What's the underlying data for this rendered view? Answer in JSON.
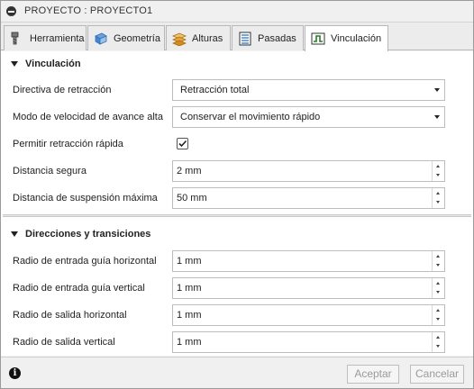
{
  "window": {
    "title": "PROYECTO : PROYECTO1"
  },
  "tabs": [
    {
      "label": "Herramienta",
      "icon": "tool-icon",
      "active": false
    },
    {
      "label": "Geometría",
      "icon": "geometry-icon",
      "active": false
    },
    {
      "label": "Alturas",
      "icon": "heights-icon",
      "active": false
    },
    {
      "label": "Pasadas",
      "icon": "passes-icon",
      "active": false
    },
    {
      "label": "Vinculación",
      "icon": "linking-icon",
      "active": true
    }
  ],
  "sections": {
    "linking": {
      "title": "Vinculación",
      "retract_policy": {
        "label": "Directiva de retracción",
        "value": "Retracción total"
      },
      "high_feed_mode": {
        "label": "Modo de velocidad de avance alta",
        "value": "Conservar el movimiento rápido"
      },
      "allow_rapid_retract": {
        "label": "Permitir retracción rápida",
        "checked": true
      },
      "safe_distance": {
        "label": "Distancia segura",
        "value": "2 mm"
      },
      "max_stay_down": {
        "label": "Distancia de suspensión máxima",
        "value": "50 mm"
      }
    },
    "leads": {
      "title": "Direcciones y transiciones",
      "horizontal_lead_in": {
        "label": "Radio de entrada guía horizontal",
        "value": "1 mm"
      },
      "vertical_lead_in": {
        "label": "Radio de entrada guía vertical",
        "value": "1 mm"
      },
      "horizontal_lead_out": {
        "label": "Radio de salida horizontal",
        "value": "1 mm"
      },
      "vertical_lead_out": {
        "label": "Radio de salida vertical",
        "value": "1 mm"
      }
    }
  },
  "footer": {
    "ok_label": "Aceptar",
    "cancel_label": "Cancelar"
  },
  "colors": {
    "accent_icon": "#2a7a2a",
    "geometry_blue": "#2f6fbf",
    "heights_orange": "#e8a33a"
  }
}
